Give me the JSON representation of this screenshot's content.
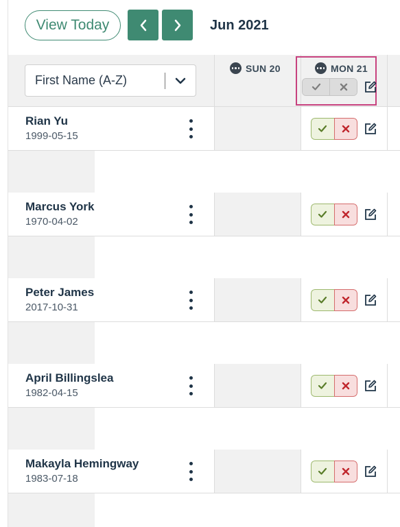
{
  "toolbar": {
    "view_today_label": "View Today",
    "prev_icon": "chevron-left-icon",
    "next_icon": "chevron-right-icon",
    "month_label": "Jun 2021"
  },
  "header": {
    "sort": {
      "selected": "First Name (A-Z)"
    },
    "days": [
      {
        "label": "SUN 20",
        "weekend": true
      },
      {
        "label": "MON 21",
        "weekend": false
      }
    ]
  },
  "students": [
    {
      "name": "Rian Yu",
      "dob": "1999-05-15"
    },
    {
      "name": "Marcus York",
      "dob": "1970-04-02"
    },
    {
      "name": "Peter James",
      "dob": "2017-10-31"
    },
    {
      "name": "April Billingslea",
      "dob": "1982-04-15"
    },
    {
      "name": "Makayla Hemingway",
      "dob": "1983-07-18"
    }
  ],
  "colors": {
    "brand": "#3f8a72",
    "present": "#5a7d2a",
    "absent": "#c0262d",
    "highlight": "#c7417e"
  }
}
